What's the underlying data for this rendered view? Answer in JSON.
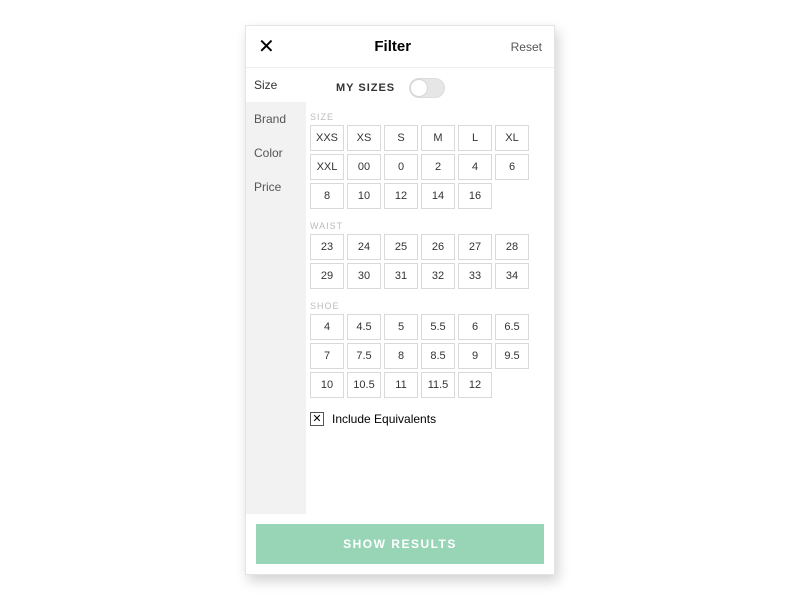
{
  "header": {
    "close_glyph": "✕",
    "title": "Filter",
    "reset_label": "Reset"
  },
  "sidebar": {
    "categories": [
      {
        "label": "Size",
        "active": true
      },
      {
        "label": "Brand",
        "active": false
      },
      {
        "label": "Color",
        "active": false
      },
      {
        "label": "Price",
        "active": false
      }
    ]
  },
  "mysizes": {
    "label": "MY SIZES",
    "on": false
  },
  "sections": [
    {
      "label": "SIZE",
      "options": [
        "XXS",
        "XS",
        "S",
        "M",
        "L",
        "XL",
        "XXL",
        "00",
        "0",
        "2",
        "4",
        "6",
        "8",
        "10",
        "12",
        "14",
        "16"
      ]
    },
    {
      "label": "WAIST",
      "options": [
        "23",
        "24",
        "25",
        "26",
        "27",
        "28",
        "29",
        "30",
        "31",
        "32",
        "33",
        "34"
      ]
    },
    {
      "label": "SHOE",
      "options": [
        "4",
        "4.5",
        "5",
        "5.5",
        "6",
        "6.5",
        "7",
        "7.5",
        "8",
        "8.5",
        "9",
        "9.5",
        "10",
        "10.5",
        "11",
        "11.5",
        "12"
      ]
    }
  ],
  "include": {
    "checked": true,
    "check_glyph": "✕",
    "label": "Include Equivalents"
  },
  "footer": {
    "button_label": "SHOW RESULTS"
  }
}
